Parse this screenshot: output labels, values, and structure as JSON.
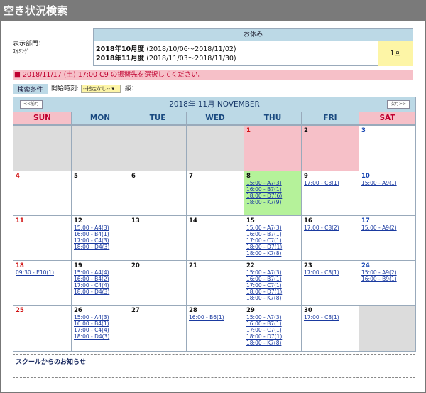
{
  "page": {
    "title": "空き状況検索"
  },
  "department": {
    "label": "表示部門：",
    "value": "ｽｲﾐﾝｸﾞ"
  },
  "holiday": {
    "header": "お休み",
    "lines": [
      {
        "month": "2018年10月度",
        "range": "(2018/10/06～2018/11/02)"
      },
      {
        "month": "2018年11月度",
        "range": "(2018/11/03～2018/11/30)"
      }
    ],
    "count": "1回"
  },
  "notice": "■ 2018/11/17 (土) 17:00 C9 の振替先を選択してください。",
  "conditions": {
    "button": "検索条件",
    "start_label": "開始時刻:",
    "select_value": "--指定なし--",
    "tail": "級："
  },
  "calendar": {
    "title": "2018年 11月 NOVEMBER",
    "prev": "<<前月",
    "next": "次月>>",
    "weekdays": [
      "SUN",
      "MON",
      "TUE",
      "WED",
      "THU",
      "FRI",
      "SAT"
    ],
    "weeks": [
      [
        {
          "day": "",
          "type": "empty",
          "slots": []
        },
        {
          "day": "",
          "type": "empty",
          "slots": []
        },
        {
          "day": "",
          "type": "empty",
          "slots": []
        },
        {
          "day": "",
          "type": "empty",
          "slots": []
        },
        {
          "day": "1",
          "type": "holiday",
          "color": "red",
          "slots": []
        },
        {
          "day": "2",
          "type": "holiday",
          "color": "normal",
          "slots": []
        },
        {
          "day": "3",
          "type": "normal",
          "color": "blue",
          "slots": []
        }
      ],
      [
        {
          "day": "4",
          "type": "normal",
          "color": "red",
          "slots": []
        },
        {
          "day": "5",
          "type": "normal",
          "color": "normal",
          "slots": []
        },
        {
          "day": "6",
          "type": "normal",
          "color": "normal",
          "slots": []
        },
        {
          "day": "7",
          "type": "normal",
          "color": "normal",
          "slots": []
        },
        {
          "day": "8",
          "type": "selected",
          "color": "normal",
          "slots": [
            "15:00 - A7(3)",
            "16:00 - B7(1)",
            "18:00 - D7(6)",
            "18:00 - K7(9)"
          ]
        },
        {
          "day": "9",
          "type": "normal",
          "color": "normal",
          "slots": [
            "17:00 - C8(1)"
          ]
        },
        {
          "day": "10",
          "type": "normal",
          "color": "blue",
          "slots": [
            "15:00 - A9(1)"
          ]
        }
      ],
      [
        {
          "day": "11",
          "type": "normal",
          "color": "red",
          "slots": []
        },
        {
          "day": "12",
          "type": "normal",
          "color": "normal",
          "slots": [
            "15:00 - A4(3)",
            "16:00 - B4(1)",
            "17:00 - C4(3)",
            "18:00 - D4(3)"
          ]
        },
        {
          "day": "13",
          "type": "normal",
          "color": "normal",
          "slots": []
        },
        {
          "day": "14",
          "type": "normal",
          "color": "normal",
          "slots": []
        },
        {
          "day": "15",
          "type": "normal",
          "color": "normal",
          "slots": [
            "15:00 - A7(3)",
            "16:00 - B7(1)",
            "17:00 - C7(1)",
            "18:00 - D7(1)",
            "18:00 - K7(8)"
          ]
        },
        {
          "day": "16",
          "type": "normal",
          "color": "normal",
          "slots": [
            "17:00 - C8(2)"
          ]
        },
        {
          "day": "17",
          "type": "normal",
          "color": "blue",
          "slots": [
            "15:00 - A9(2)"
          ]
        }
      ],
      [
        {
          "day": "18",
          "type": "normal",
          "color": "red",
          "slots": [
            "09:30 - E10(1)"
          ]
        },
        {
          "day": "19",
          "type": "normal",
          "color": "normal",
          "slots": [
            "15:00 - A4(4)",
            "16:00 - B4(2)",
            "17:00 - C4(4)",
            "18:00 - D4(3)"
          ]
        },
        {
          "day": "20",
          "type": "normal",
          "color": "normal",
          "slots": []
        },
        {
          "day": "21",
          "type": "normal",
          "color": "normal",
          "slots": []
        },
        {
          "day": "22",
          "type": "normal",
          "color": "normal",
          "slots": [
            "15:00 - A7(3)",
            "16:00 - B7(1)",
            "17:00 - C7(1)",
            "18:00 - D7(1)",
            "18:00 - K7(8)"
          ]
        },
        {
          "day": "23",
          "type": "normal",
          "color": "normal",
          "slots": [
            "17:00 - C8(1)"
          ]
        },
        {
          "day": "24",
          "type": "normal",
          "color": "blue",
          "slots": [
            "15:00 - A9(2)",
            "16:00 - B9(1)"
          ]
        }
      ],
      [
        {
          "day": "25",
          "type": "normal",
          "color": "red",
          "slots": []
        },
        {
          "day": "26",
          "type": "normal",
          "color": "normal",
          "slots": [
            "15:00 - A4(3)",
            "16:00 - B4(1)",
            "17:00 - C4(4)",
            "18:00 - D4(3)"
          ]
        },
        {
          "day": "27",
          "type": "normal",
          "color": "normal",
          "slots": []
        },
        {
          "day": "28",
          "type": "normal",
          "color": "normal",
          "slots": [
            "16:00 - B6(1)"
          ]
        },
        {
          "day": "29",
          "type": "normal",
          "color": "normal",
          "slots": [
            "15:00 - A7(3)",
            "16:00 - B7(1)",
            "17:00 - C7(1)",
            "18:00 - D7(1)",
            "18:00 - K7(8)"
          ]
        },
        {
          "day": "30",
          "type": "normal",
          "color": "normal",
          "slots": [
            "17:00 - C8(1)"
          ]
        },
        {
          "day": "",
          "type": "empty",
          "slots": []
        }
      ]
    ]
  },
  "news": {
    "title": "スクールからのお知らせ"
  }
}
